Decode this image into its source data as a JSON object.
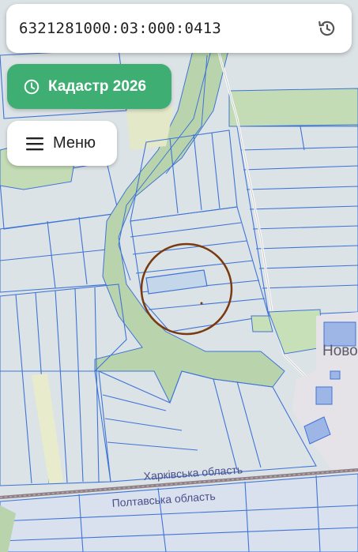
{
  "search": {
    "value": "6321281000:03:000:0413"
  },
  "cadastre_button": {
    "label": "Кадастр 2026"
  },
  "menu_button": {
    "label": "Меню"
  },
  "map": {
    "region_labels": [
      "Харківська область",
      "Полтавська область"
    ],
    "place_label": "Ново"
  },
  "colors": {
    "accent": "#3fae73",
    "parcel_line": "#3f74d6",
    "marker_ring": "#7a3a10",
    "green_area": "#b8d8a8"
  },
  "icons": {
    "history": "history-icon",
    "clock": "clock-icon",
    "menu": "hamburger-icon"
  }
}
